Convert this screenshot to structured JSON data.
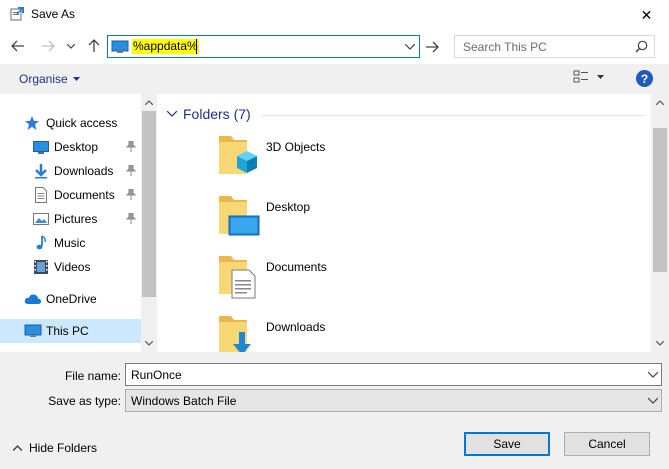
{
  "window": {
    "title": "Save As",
    "close_glyph": "✕"
  },
  "address": {
    "value": "%appdata%",
    "search_placeholder": "Search This PC"
  },
  "toolbar": {
    "organise_label": "Organise",
    "help_glyph": "?"
  },
  "nav": {
    "items": [
      {
        "label": "Quick access",
        "icon": "star-icon"
      },
      {
        "label": "Desktop",
        "icon": "desktop-icon",
        "pinned": true
      },
      {
        "label": "Downloads",
        "icon": "download-icon",
        "pinned": true
      },
      {
        "label": "Documents",
        "icon": "document-icon",
        "pinned": true
      },
      {
        "label": "Pictures",
        "icon": "picture-icon",
        "pinned": true
      },
      {
        "label": "Music",
        "icon": "music-icon"
      },
      {
        "label": "Videos",
        "icon": "video-icon"
      },
      {
        "label": "OneDrive",
        "icon": "cloud-icon"
      },
      {
        "label": "This PC",
        "icon": "computer-icon",
        "selected": true
      }
    ]
  },
  "content": {
    "group_header": "Folders (7)",
    "folders": [
      {
        "label": "3D Objects",
        "icon": "3d-objects-folder-icon"
      },
      {
        "label": "Desktop",
        "icon": "desktop-folder-icon"
      },
      {
        "label": "Documents",
        "icon": "documents-folder-icon"
      },
      {
        "label": "Downloads",
        "icon": "downloads-folder-icon"
      }
    ]
  },
  "form": {
    "filename_label": "File name:",
    "filename_value": "RunOnce",
    "savetype_label": "Save as type:",
    "savetype_value": "Windows Batch File"
  },
  "footer": {
    "hide_folders_label": "Hide Folders",
    "save_label": "Save",
    "cancel_label": "Cancel"
  },
  "colors": {
    "accent": "#0078d7",
    "link_blue": "#1e3287",
    "selection": "#cce8ff",
    "highlight": "#ffff00",
    "folder_yellow": "#f8d775"
  }
}
